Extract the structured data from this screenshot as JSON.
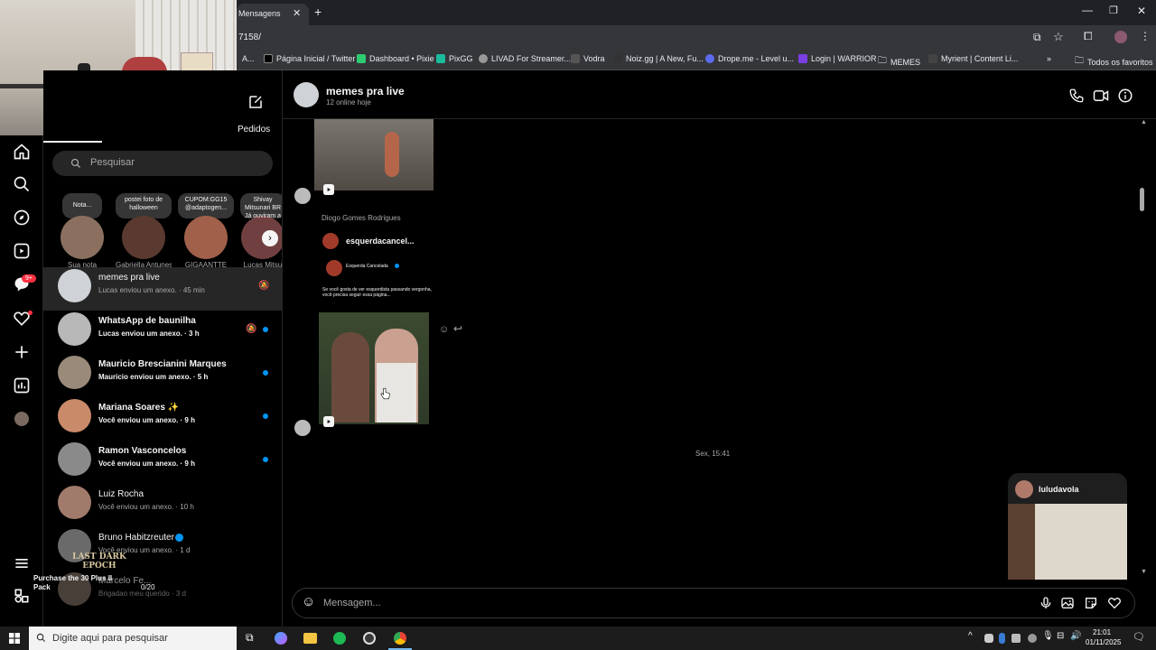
{
  "browser": {
    "tab_title": "Mensagens",
    "url": "7158/",
    "bookmarks": [
      "A...",
      "Página Inicial / Twitter",
      "Dashboard • Pixie",
      "PixGG",
      "LIVAD For Streamer...",
      "Vodra",
      "Noiz.gg | A New, Fu...",
      "Drope.me - Level u...",
      "Login | WARRIOR",
      "MEMES",
      "Myrient | Content Li...",
      "Todos os favoritos"
    ]
  },
  "sidebar": {
    "compose_label": "Pedidos",
    "notification_badge": "9+"
  },
  "search": {
    "placeholder": "Pesquisar"
  },
  "notes": [
    {
      "bubble": "Nota...",
      "name": "Sua nota"
    },
    {
      "bubble": "postei foto de halloween",
      "name": "Gabriella Antunes"
    },
    {
      "bubble": "CUPOM:GG15 @adaptogen...",
      "name": "GIGAANTTE"
    },
    {
      "bubble": "Shivay Mitsunari BR Já ouviram a",
      "name": "Lucas Mitsu"
    }
  ],
  "conversations": [
    {
      "name": "memes pra live",
      "sub": "Lucas enviou um anexo. · 45 min"
    },
    {
      "name": "WhatsApp de baunilha",
      "sub": "Lucas enviou um anexo. · 3 h"
    },
    {
      "name": "Mauricio Brescianini Marques",
      "sub": "Mauricio enviou um anexo. · 5 h"
    },
    {
      "name": "Mariana Soares ✨",
      "sub": "Você enviou um anexo. · 9 h"
    },
    {
      "name": "Ramon Vasconcelos",
      "sub": "Você enviou um anexo. · 9 h"
    },
    {
      "name": "Luiz Rocha",
      "sub": "Você enviou um anexo. · 10 h"
    },
    {
      "name": "Bruno Habitzreuter",
      "sub": "Você enviou um anexo. · 1 d"
    },
    {
      "name": "Marcelo Fe...",
      "sub": "Brigadao meu querido · 3 d"
    }
  ],
  "overlay": {
    "game_title": "LAST DARK EPOCH",
    "promo": "Purchase the 30 Plus II Pack",
    "counter": "0/20"
  },
  "chat": {
    "title": "memes pra live",
    "status": "12 online hoje",
    "sender_name": "Diogo Gomes Rodrigues",
    "shared_account": "esquerdacancel...",
    "post_account": "Esquerda Cancelada",
    "post_caption": "Se você gosta de ver esquerdista passando vergonha, você precisa seguir essa página...",
    "timestamp": "Sex, 15:41",
    "reel_user": "luludavola",
    "composer_placeholder": "Mensagem..."
  },
  "taskbar": {
    "search_placeholder": "Digite aqui para pesquisar",
    "time": "21:01",
    "date": "01/11/2025"
  }
}
